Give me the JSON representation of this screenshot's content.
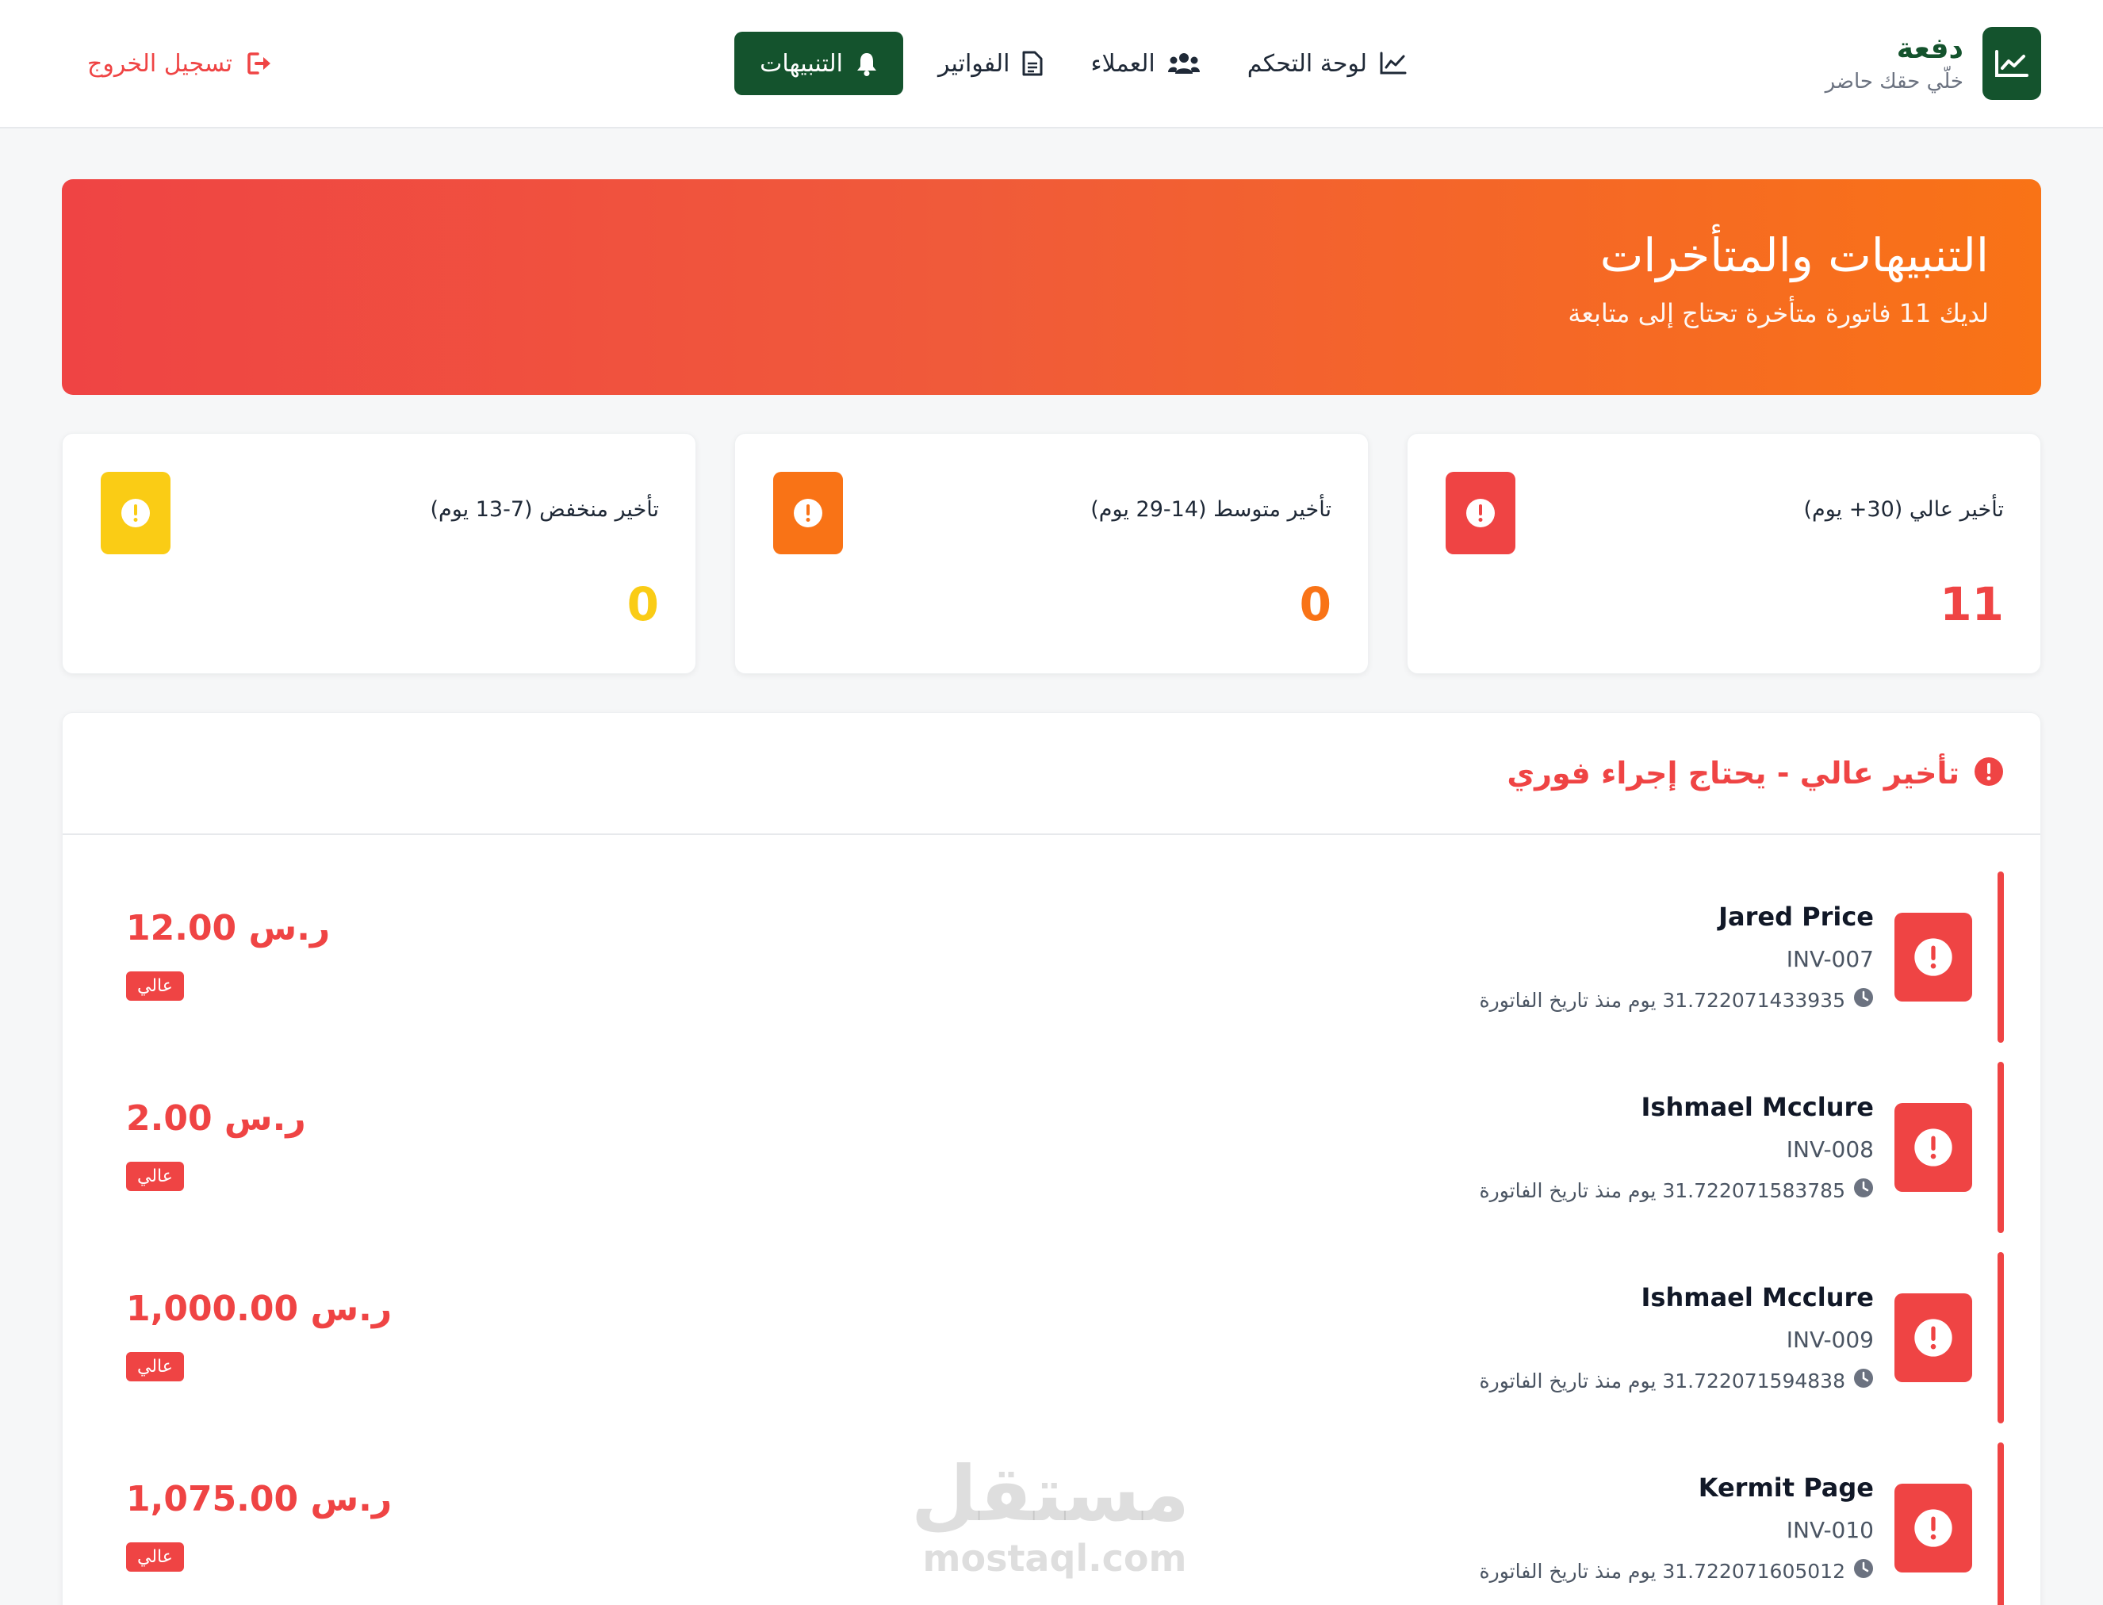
{
  "brand": {
    "name": "دفعة",
    "tagline": "خلّي حقك حاضر",
    "logo_icon": "chart-line-icon"
  },
  "nav": {
    "items": [
      {
        "label": "لوحة التحكم",
        "icon": "chart-line-icon"
      },
      {
        "label": "العملاء",
        "icon": "users-icon"
      },
      {
        "label": "الفواتير",
        "icon": "document-icon"
      },
      {
        "label": "التنبيهات",
        "icon": "bell-icon",
        "active": true
      }
    ],
    "logout_label": "تسجيل الخروج"
  },
  "hero": {
    "title": "التنبيهات والمتأخرات",
    "subtitle": "لديك 11 فاتورة متأخرة تحتاج إلى متابعة"
  },
  "stats": [
    {
      "label": "تأخير عالي (30+ يوم)",
      "value": "11",
      "color": "#ef4444"
    },
    {
      "label": "تأخير متوسط (14-29 يوم)",
      "value": "0",
      "color": "#f97316"
    },
    {
      "label": "تأخير منخفض (7-13 يوم)",
      "value": "0",
      "color": "#facc15"
    }
  ],
  "high_section": {
    "title": "تأخير عالي - يحتاج إجراء فوري",
    "items": [
      {
        "name": "Jared Price",
        "invoice": "INV-007",
        "days": "31.722071433935 يوم منذ تاريخ الفاتورة",
        "amount": "12.00 ر.س",
        "badge": "عالي"
      },
      {
        "name": "Ishmael Mcclure",
        "invoice": "INV-008",
        "days": "31.722071583785 يوم منذ تاريخ الفاتورة",
        "amount": "2.00 ر.س",
        "badge": "عالي"
      },
      {
        "name": "Ishmael Mcclure",
        "invoice": "INV-009",
        "days": "31.722071594838 يوم منذ تاريخ الفاتورة",
        "amount": "1,000.00 ر.س",
        "badge": "عالي"
      },
      {
        "name": "Kermit Page",
        "invoice": "INV-010",
        "days": "31.722071605012 يوم منذ تاريخ الفاتورة",
        "amount": "1,075.00 ر.س",
        "badge": "عالي"
      }
    ]
  },
  "watermark": {
    "arabic": "مستقل",
    "latin": "mostaql.com"
  },
  "colors": {
    "brand": "#14532d",
    "danger": "#ef4444",
    "warning": "#f97316",
    "low": "#facc15"
  }
}
